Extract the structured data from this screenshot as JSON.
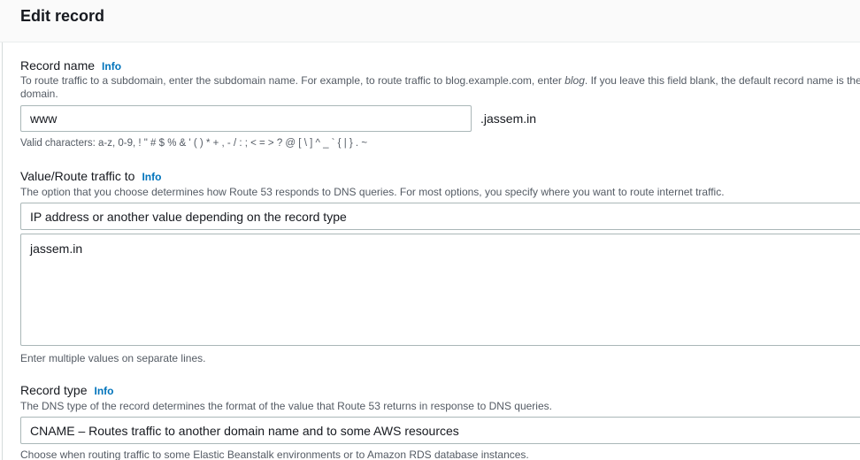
{
  "header": {
    "title": "Edit record"
  },
  "record_name": {
    "label": "Record name",
    "info": "Info",
    "description_before": "To route traffic to a subdomain, enter the subdomain name. For example, to route traffic to blog.example.com, enter ",
    "description_em": "blog",
    "description_after": ". If you leave this field blank, the default record name is the domain.",
    "value": "www",
    "suffix": ".jassem.in",
    "hint": "Valid characters: a-z, 0-9, ! \" # $ % & ' ( ) * + , - / : ; < = > ? @ [ \\ ] ^ _ ` { | } . ~"
  },
  "value_route": {
    "label": "Value/Route traffic to",
    "info": "Info",
    "description": "The option that you choose determines how Route 53 responds to DNS queries. For most options, you specify where you want to route internet traffic.",
    "selected_option": "IP address or another value depending on the record type",
    "textarea_value": "jassem.in",
    "hint": "Enter multiple values on separate lines."
  },
  "record_type": {
    "label": "Record type",
    "info": "Info",
    "description": "The DNS type of the record determines the format of the value that Route 53 returns in response to DNS queries.",
    "selected_option": "CNAME – Routes traffic to another domain name and to some AWS resources",
    "hint": "Choose when routing traffic to some Elastic Beanstalk environments or to Amazon RDS database instances."
  }
}
